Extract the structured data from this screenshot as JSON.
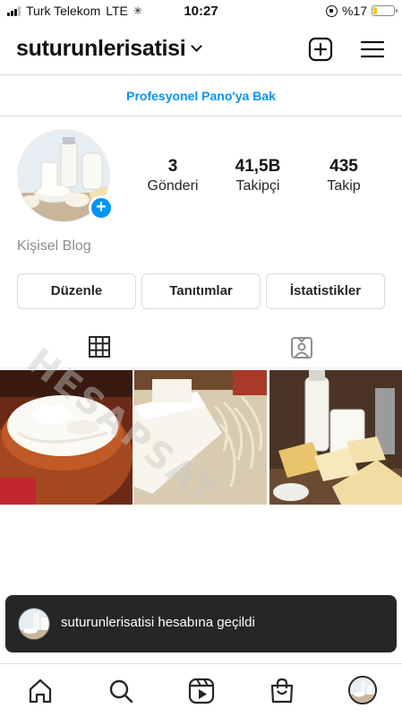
{
  "status_bar": {
    "carrier": "Turk Telekom",
    "network": "LTE",
    "time": "10:27",
    "battery": "%17",
    "battery_level": 0.17,
    "icons": [
      "signal-icon",
      "loading-icon",
      "orientation-lock-icon",
      "battery-icon"
    ]
  },
  "header": {
    "username": "suturunlerisatisi",
    "icons": [
      "chevron-down-icon",
      "add-square-icon",
      "menu-icon"
    ]
  },
  "banner": {
    "label": "Profesyonel Pano'ya Bak"
  },
  "profile": {
    "stats": [
      {
        "value": "3",
        "label": "Gönderi"
      },
      {
        "value": "41,5B",
        "label": "Takipçi"
      },
      {
        "value": "435",
        "label": "Takip"
      }
    ],
    "category": "Kişisel Blog",
    "buttons": [
      "Düzenle",
      "Tanıtımlar",
      "İstatistikler"
    ]
  },
  "tabs": {
    "icons": [
      "grid-icon",
      "tagged-icon"
    ],
    "selected": "grid"
  },
  "posts_count_visible": 3,
  "watermark": "HESAPSAT",
  "toast": {
    "text": "suturunlerisatisi hesabına geçildi"
  },
  "bottom_nav": {
    "icons": [
      "home-icon",
      "search-icon",
      "reels-icon",
      "shop-icon",
      "profile-avatar"
    ]
  },
  "colors": {
    "accent_blue": "#0095f6",
    "text": "#262626",
    "muted": "#8e8e8e",
    "toast_bg": "#262626",
    "battery_yellow": "#f7c820"
  }
}
